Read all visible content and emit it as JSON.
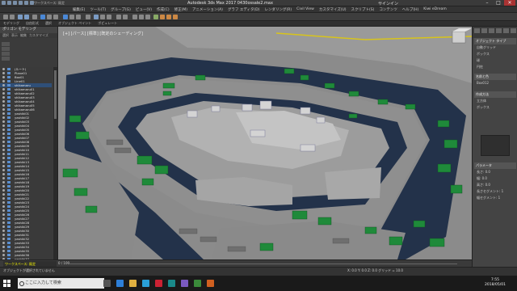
{
  "window": {
    "title": "Autodesk 3ds Max 2017    0430ossale2.max",
    "workspace": "ワークスペース: 既定",
    "sign_in": "サインイン",
    "controls": [
      "–",
      "□",
      "✕"
    ]
  },
  "menubar": {
    "items": [
      "編集(E)",
      "ツール(T)",
      "グループ(G)",
      "ビュー(V)",
      "作成(C)",
      "修正(M)",
      "アニメーション(A)",
      "グラフ エディタ(D)",
      "レンダリング(R)",
      "Civil View",
      "カスタマイズ(U)",
      "スクリプト(S)",
      "コンテンツ",
      "ヘルプ(H)",
      "Kiwi eDream"
    ]
  },
  "ribbon": {
    "tabs": [
      "モデリング",
      "自由形式",
      "選択",
      "オブジェクト ペイント",
      "ポピュレート"
    ]
  },
  "explorer": {
    "title": "ポリゴン モデリング",
    "tabs": [
      "選択",
      "表示",
      "編集",
      "カスタマイズ"
    ],
    "items": [
      "(ルート)",
      "Plane01",
      "Box01",
      "Line01",
      "shikamaru",
      "shikamaru01",
      "shikamaru02",
      "shikamaru03",
      "shikamaru04",
      "shikamaru05",
      "shikamaru06",
      "yashiki01",
      "yashiki02",
      "yashiki03",
      "yashiki04",
      "yashiki05",
      "yashiki06",
      "yashiki07",
      "yashiki08",
      "yashiki09",
      "yashiki10",
      "yashiki11",
      "yashiki12",
      "yashiki13",
      "yashiki14",
      "yashiki15",
      "yashiki16",
      "yashiki17",
      "yashiki18",
      "yashiki19",
      "yashiki20",
      "yashiki21",
      "yashiki22",
      "yashiki23",
      "yashiki24",
      "yashiki25",
      "yashiki26",
      "yashiki27",
      "yashiki28",
      "yashiki29",
      "yashiki30",
      "yashiki31",
      "yashiki32",
      "yashiki33",
      "yashiki34",
      "yashiki35",
      "yashiki36",
      "yashiki37"
    ],
    "selected_index": 4
  },
  "viewport": {
    "label": "[+] [パース] [標準] [既定のシェーディング]"
  },
  "command_panel": {
    "sections": [
      {
        "title": "オブジェクト タイプ",
        "lines": [
          "自動グリッド",
          "ボックス",
          "球",
          "円柱"
        ]
      },
      {
        "title": "名前と色",
        "lines": [
          "Box012"
        ]
      },
      {
        "title": "作成方法",
        "lines": [
          "立方体",
          "ボックス"
        ]
      },
      {
        "title": "パラメータ",
        "lines": [
          "長さ: 0.0",
          "幅: 0.0",
          "高さ: 0.0",
          "長さセグメント: 1",
          "幅セグメント: 1"
        ]
      }
    ]
  },
  "timeline": {
    "selection_label": "ワークスペース: 既定",
    "frame": "0 / 100"
  },
  "status": {
    "text": "オブジェクトが選択されていません",
    "coords": "X: 0.0   Y: 0.0   Z: 0.0   グリッド = 10.0"
  },
  "taskbar": {
    "search_placeholder": "ここに入力して検索",
    "time": "7:55",
    "date": "2018/05/01"
  },
  "colors": {
    "water": "#23324a",
    "ground": "#8f8f8f",
    "roof": "#1f8a3a",
    "wall": "#c8c8c8",
    "selection": "#2f4f78"
  }
}
